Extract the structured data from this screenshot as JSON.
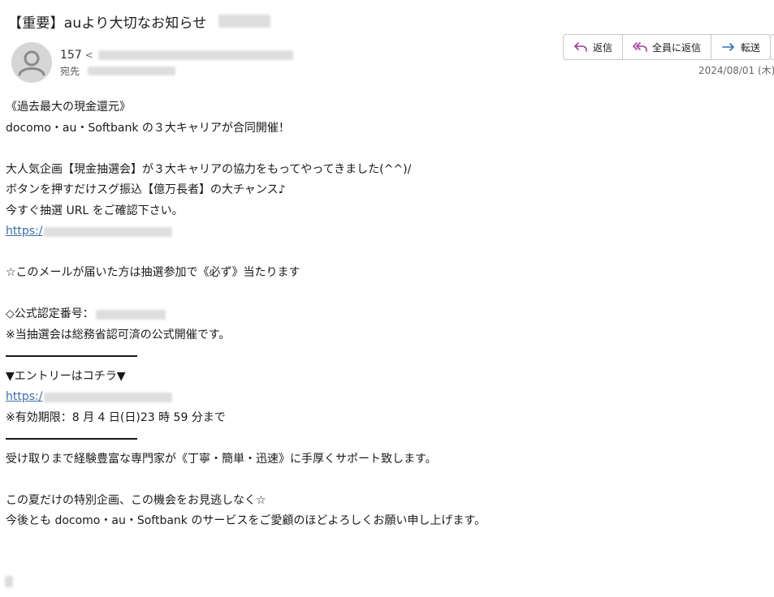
{
  "message": {
    "subject": "【重要】auより大切なお知らせ",
    "from_name": "157",
    "from_bracket": "<",
    "to_label": "宛先",
    "date": "2024/08/01 (木)"
  },
  "toolbar": {
    "reply_label": "返信",
    "reply_all_label": "全員に返信",
    "forward_label": "転送"
  },
  "body": {
    "l1": "《過去最大の現金還元》",
    "l2": "docomo・au・Softbank の３大キャリアが合同開催！",
    "l3": "大人気企画【現金抽選会】が３大キャリアの協力をもってやってきました(^^)/",
    "l4": "ボタンを押すだけスグ振込【億万長者】の大チャンス♪",
    "l5": "今すぐ抽選 URL をご確認下さい。",
    "link1": "https:/",
    "l6": "☆このメールが届いた方は抽選参加で《必ず》当たります",
    "l7": "◇公式認定番号：",
    "l8": "※当抽選会は総務省認可済の公式開催です。",
    "l9": "▼エントリーはコチラ▼",
    "link2": "https:/",
    "l10": "※有効期限：8 月 4 日(日)23 時 59 分まで",
    "l11": "受け取りまで経験豊富な専門家が《丁寧・簡単・迅速》に手厚くサポート致します。",
    "l12": "この夏だけの特別企画、この機会をお見逃しなく☆",
    "l13": "今後とも docomo・au・Softbank のサービスをご愛顧のほどよろしくお願い申し上げます。"
  },
  "colors": {
    "link": "#3a6ea5",
    "reply_icon": "#a23c9b",
    "forward_icon": "#2f6fb8",
    "avatar_bg": "#d6d6d6",
    "avatar_fg": "#8a8a8a"
  }
}
